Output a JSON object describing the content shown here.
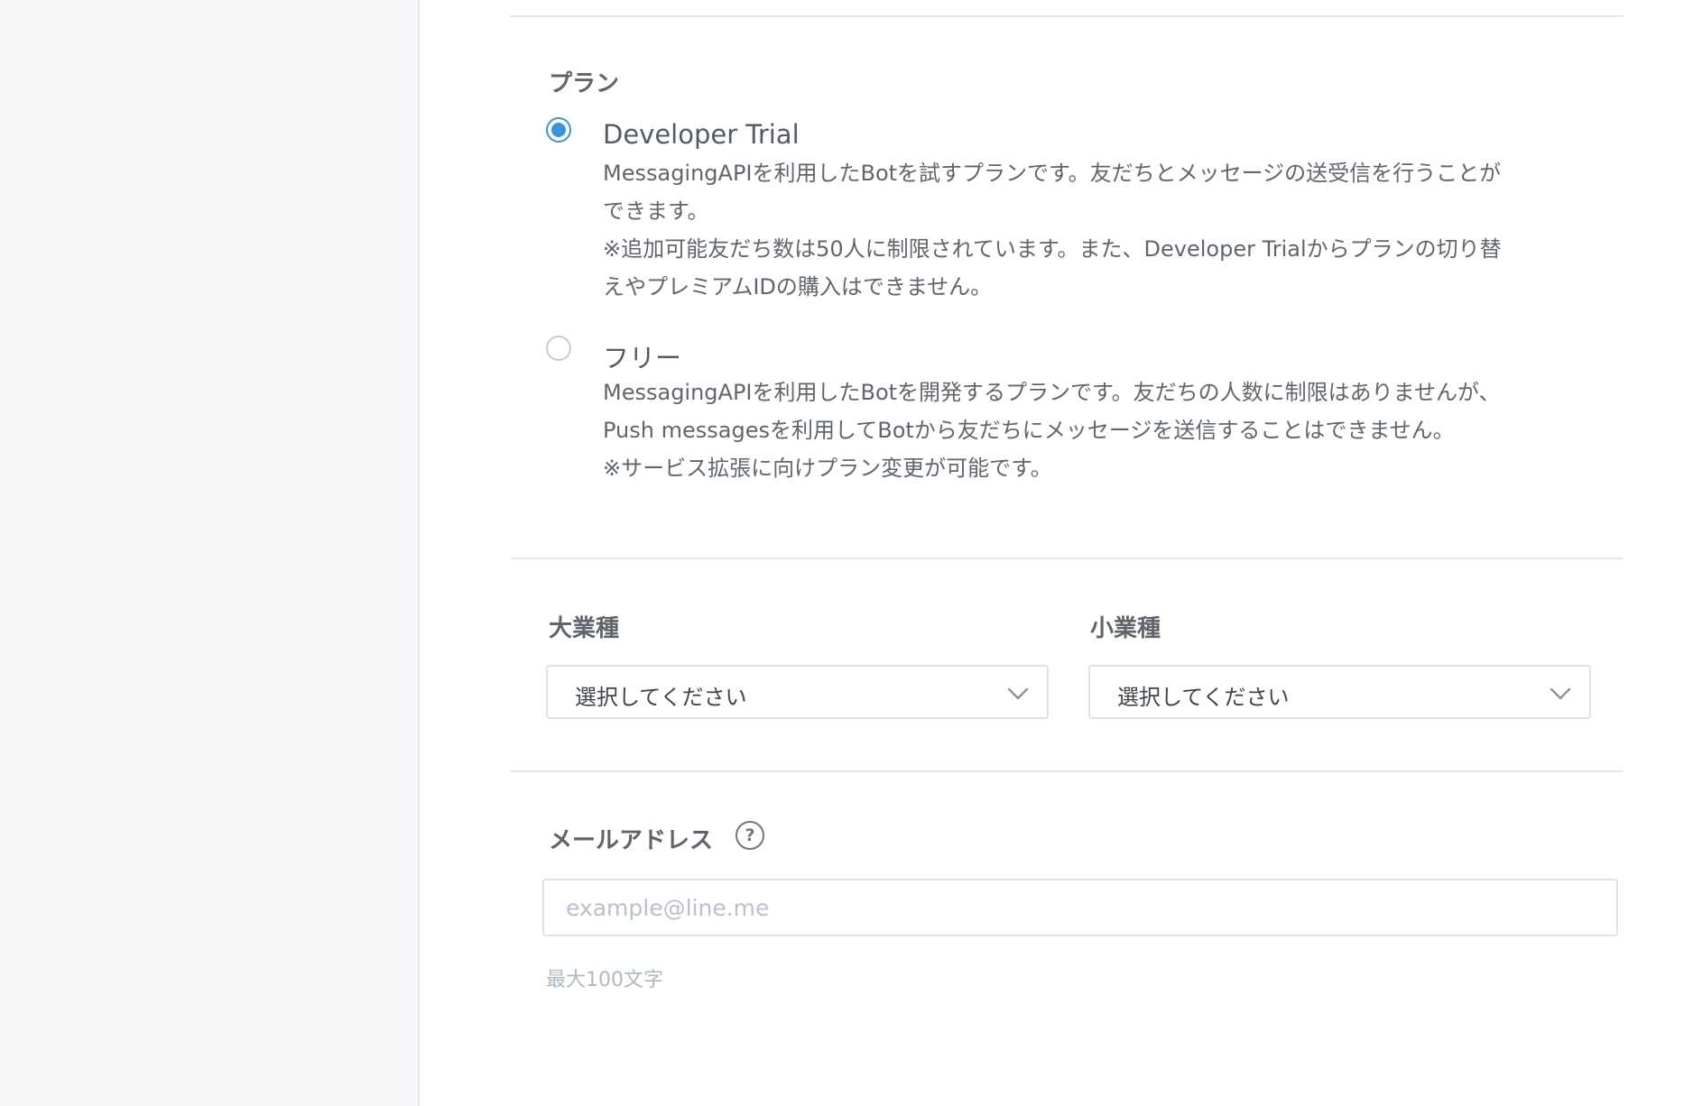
{
  "plan": {
    "label": "プラン",
    "options": [
      {
        "title": "Developer Trial",
        "selected": true,
        "description": [
          "MessagingAPIを利用したBotを試すプランです。友だちとメッセージの送受信を行うことが",
          "できます。",
          "※追加可能友だち数は50人に制限されています。また、Developer Trialからプランの切り替",
          "えやプレミアムIDの購入はできません。"
        ]
      },
      {
        "title": "フリー",
        "selected": false,
        "description": [
          "MessagingAPIを利用したBotを開発するプランです。友だちの人数に制限はありませんが、",
          "Push messagesを利用してBotから友だちにメッセージを送信することはできません。",
          "※サービス拡張に向けプラン変更が可能です。"
        ]
      }
    ]
  },
  "industry": {
    "major": {
      "label": "大業種",
      "selected_value": "選択してください"
    },
    "minor": {
      "label": "小業種",
      "selected_value": "選択してください"
    }
  },
  "email": {
    "label": "メールアドレス",
    "help_icon": "question-circle-icon",
    "placeholder": "example@line.me",
    "value": "",
    "hint": "最大100文字"
  },
  "colors": {
    "accent": "#3d93d9",
    "sidebar_bg": "#f6f8fa",
    "border": "#dfe3e8"
  }
}
